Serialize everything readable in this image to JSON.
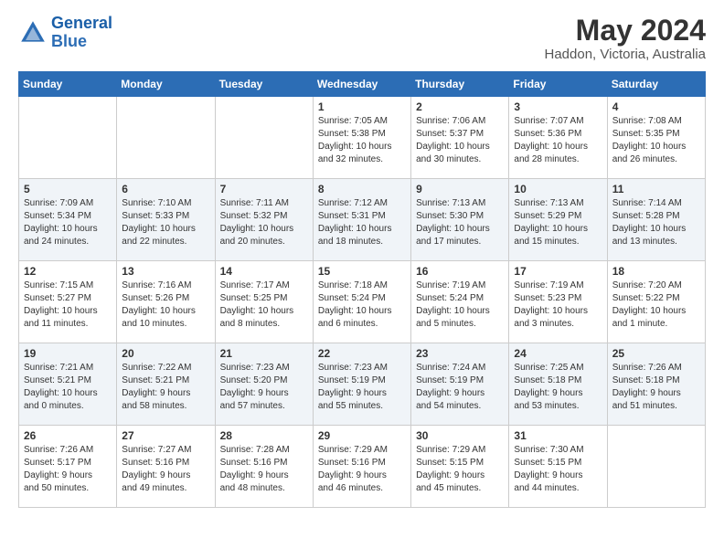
{
  "header": {
    "logo_line1": "General",
    "logo_line2": "Blue",
    "month_title": "May 2024",
    "location": "Haddon, Victoria, Australia"
  },
  "weekdays": [
    "Sunday",
    "Monday",
    "Tuesday",
    "Wednesday",
    "Thursday",
    "Friday",
    "Saturday"
  ],
  "weeks": [
    [
      {
        "day": "",
        "info": ""
      },
      {
        "day": "",
        "info": ""
      },
      {
        "day": "",
        "info": ""
      },
      {
        "day": "1",
        "info": "Sunrise: 7:05 AM\nSunset: 5:38 PM\nDaylight: 10 hours\nand 32 minutes."
      },
      {
        "day": "2",
        "info": "Sunrise: 7:06 AM\nSunset: 5:37 PM\nDaylight: 10 hours\nand 30 minutes."
      },
      {
        "day": "3",
        "info": "Sunrise: 7:07 AM\nSunset: 5:36 PM\nDaylight: 10 hours\nand 28 minutes."
      },
      {
        "day": "4",
        "info": "Sunrise: 7:08 AM\nSunset: 5:35 PM\nDaylight: 10 hours\nand 26 minutes."
      }
    ],
    [
      {
        "day": "5",
        "info": "Sunrise: 7:09 AM\nSunset: 5:34 PM\nDaylight: 10 hours\nand 24 minutes."
      },
      {
        "day": "6",
        "info": "Sunrise: 7:10 AM\nSunset: 5:33 PM\nDaylight: 10 hours\nand 22 minutes."
      },
      {
        "day": "7",
        "info": "Sunrise: 7:11 AM\nSunset: 5:32 PM\nDaylight: 10 hours\nand 20 minutes."
      },
      {
        "day": "8",
        "info": "Sunrise: 7:12 AM\nSunset: 5:31 PM\nDaylight: 10 hours\nand 18 minutes."
      },
      {
        "day": "9",
        "info": "Sunrise: 7:13 AM\nSunset: 5:30 PM\nDaylight: 10 hours\nand 17 minutes."
      },
      {
        "day": "10",
        "info": "Sunrise: 7:13 AM\nSunset: 5:29 PM\nDaylight: 10 hours\nand 15 minutes."
      },
      {
        "day": "11",
        "info": "Sunrise: 7:14 AM\nSunset: 5:28 PM\nDaylight: 10 hours\nand 13 minutes."
      }
    ],
    [
      {
        "day": "12",
        "info": "Sunrise: 7:15 AM\nSunset: 5:27 PM\nDaylight: 10 hours\nand 11 minutes."
      },
      {
        "day": "13",
        "info": "Sunrise: 7:16 AM\nSunset: 5:26 PM\nDaylight: 10 hours\nand 10 minutes."
      },
      {
        "day": "14",
        "info": "Sunrise: 7:17 AM\nSunset: 5:25 PM\nDaylight: 10 hours\nand 8 minutes."
      },
      {
        "day": "15",
        "info": "Sunrise: 7:18 AM\nSunset: 5:24 PM\nDaylight: 10 hours\nand 6 minutes."
      },
      {
        "day": "16",
        "info": "Sunrise: 7:19 AM\nSunset: 5:24 PM\nDaylight: 10 hours\nand 5 minutes."
      },
      {
        "day": "17",
        "info": "Sunrise: 7:19 AM\nSunset: 5:23 PM\nDaylight: 10 hours\nand 3 minutes."
      },
      {
        "day": "18",
        "info": "Sunrise: 7:20 AM\nSunset: 5:22 PM\nDaylight: 10 hours\nand 1 minute."
      }
    ],
    [
      {
        "day": "19",
        "info": "Sunrise: 7:21 AM\nSunset: 5:21 PM\nDaylight: 10 hours\nand 0 minutes."
      },
      {
        "day": "20",
        "info": "Sunrise: 7:22 AM\nSunset: 5:21 PM\nDaylight: 9 hours\nand 58 minutes."
      },
      {
        "day": "21",
        "info": "Sunrise: 7:23 AM\nSunset: 5:20 PM\nDaylight: 9 hours\nand 57 minutes."
      },
      {
        "day": "22",
        "info": "Sunrise: 7:23 AM\nSunset: 5:19 PM\nDaylight: 9 hours\nand 55 minutes."
      },
      {
        "day": "23",
        "info": "Sunrise: 7:24 AM\nSunset: 5:19 PM\nDaylight: 9 hours\nand 54 minutes."
      },
      {
        "day": "24",
        "info": "Sunrise: 7:25 AM\nSunset: 5:18 PM\nDaylight: 9 hours\nand 53 minutes."
      },
      {
        "day": "25",
        "info": "Sunrise: 7:26 AM\nSunset: 5:18 PM\nDaylight: 9 hours\nand 51 minutes."
      }
    ],
    [
      {
        "day": "26",
        "info": "Sunrise: 7:26 AM\nSunset: 5:17 PM\nDaylight: 9 hours\nand 50 minutes."
      },
      {
        "day": "27",
        "info": "Sunrise: 7:27 AM\nSunset: 5:16 PM\nDaylight: 9 hours\nand 49 minutes."
      },
      {
        "day": "28",
        "info": "Sunrise: 7:28 AM\nSunset: 5:16 PM\nDaylight: 9 hours\nand 48 minutes."
      },
      {
        "day": "29",
        "info": "Sunrise: 7:29 AM\nSunset: 5:16 PM\nDaylight: 9 hours\nand 46 minutes."
      },
      {
        "day": "30",
        "info": "Sunrise: 7:29 AM\nSunset: 5:15 PM\nDaylight: 9 hours\nand 45 minutes."
      },
      {
        "day": "31",
        "info": "Sunrise: 7:30 AM\nSunset: 5:15 PM\nDaylight: 9 hours\nand 44 minutes."
      },
      {
        "day": "",
        "info": ""
      }
    ]
  ]
}
